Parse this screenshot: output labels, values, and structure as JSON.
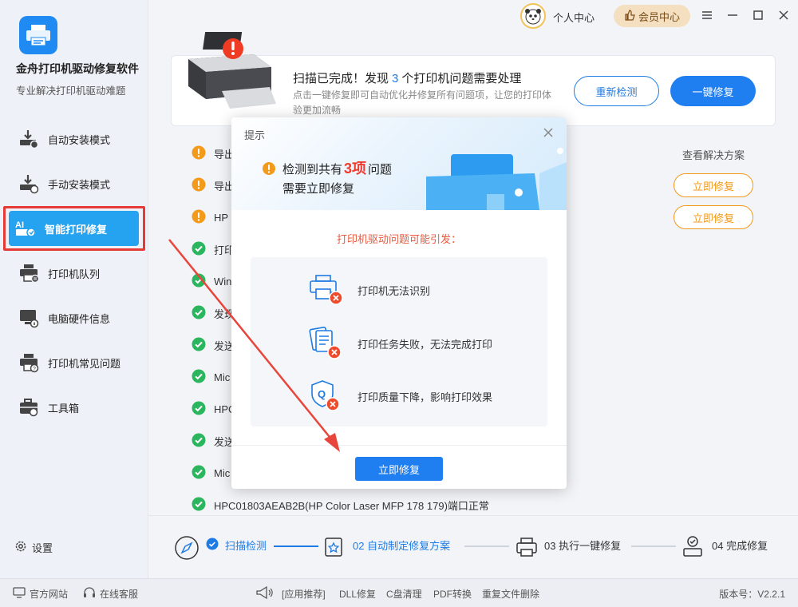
{
  "app": {
    "title": "金舟打印机驱动修复软件",
    "subtitle": "专业解决打印机驱动难题",
    "logo_icon": "printer-logo-icon",
    "accent": "#1f7ff0"
  },
  "sidebar": {
    "items": [
      {
        "label": "自动安装模式",
        "icon": "auto-install-icon"
      },
      {
        "label": "手动安装模式",
        "icon": "manual-install-icon"
      },
      {
        "label": "智能打印修复",
        "icon": "ai-repair-icon",
        "active": true
      },
      {
        "label": "打印机队列",
        "icon": "printer-queue-icon"
      },
      {
        "label": "电脑硬件信息",
        "icon": "hardware-info-icon"
      },
      {
        "label": "打印机常见问题",
        "icon": "faq-icon"
      },
      {
        "label": "工具箱",
        "icon": "toolbox-icon"
      }
    ],
    "settings_label": "设置"
  },
  "topbar": {
    "personal_label": "个人中心",
    "vip_label": "会员中心"
  },
  "banner": {
    "title_prefix": "扫描已完成！发现",
    "issue_count": "3",
    "title_suffix": "个打印机问题需要处理",
    "desc": "点击一键修复即可自动优化并修复所有问题项，让您的打印体验更加流畅",
    "rescan_label": "重新检测",
    "one_click_label": "一键修复"
  },
  "results": {
    "column_header": "查看解决方案",
    "fix_label": "立即修复",
    "rows": [
      {
        "text": "导出",
        "status": "warning"
      },
      {
        "text": "导出",
        "status": "warning"
      },
      {
        "text": "HP",
        "status": "warning"
      },
      {
        "text": "打印",
        "status": "ok"
      },
      {
        "text": "Win",
        "status": "ok"
      },
      {
        "text": "发现",
        "status": "ok"
      },
      {
        "text": "发送",
        "status": "ok"
      },
      {
        "text": "Mic",
        "status": "ok"
      },
      {
        "text": "HPC",
        "status": "ok"
      },
      {
        "text": "发送",
        "status": "ok"
      },
      {
        "text": "Mic",
        "status": "ok"
      },
      {
        "text": "HPC01803AEAB2B(HP Color Laser MFP 178 179)端口正常",
        "status": "ok"
      }
    ]
  },
  "steps": [
    {
      "label": "扫描检测",
      "state": "done"
    },
    {
      "label": "02 自动制定修复方案",
      "state": "active"
    },
    {
      "label": "03 执行一键修复",
      "state": "pending"
    },
    {
      "label": "04 完成修复",
      "state": "pending"
    }
  ],
  "footer": {
    "website_label": "官方网站",
    "support_label": "在线客服",
    "recommend_label": "[应用推荐]",
    "links": [
      "DLL修复",
      "C盘清理",
      "PDF转换",
      "重复文件删除"
    ],
    "version": "版本号：V2.2.1"
  },
  "modal": {
    "title": "提示",
    "msg_prefix": "检测到共有",
    "msg_count": "3项",
    "msg_suffix": "问题",
    "msg_line2": "需要立即修复",
    "subtitle": "打印机驱动问题可能引发：",
    "issues": [
      {
        "text": "打印机无法识别",
        "icon": "printer-error-icon"
      },
      {
        "text": "打印任务失败，无法完成打印",
        "icon": "document-error-icon"
      },
      {
        "text": "打印质量下降，影响打印效果",
        "icon": "quality-error-icon"
      }
    ],
    "button_label": "立即修复"
  }
}
